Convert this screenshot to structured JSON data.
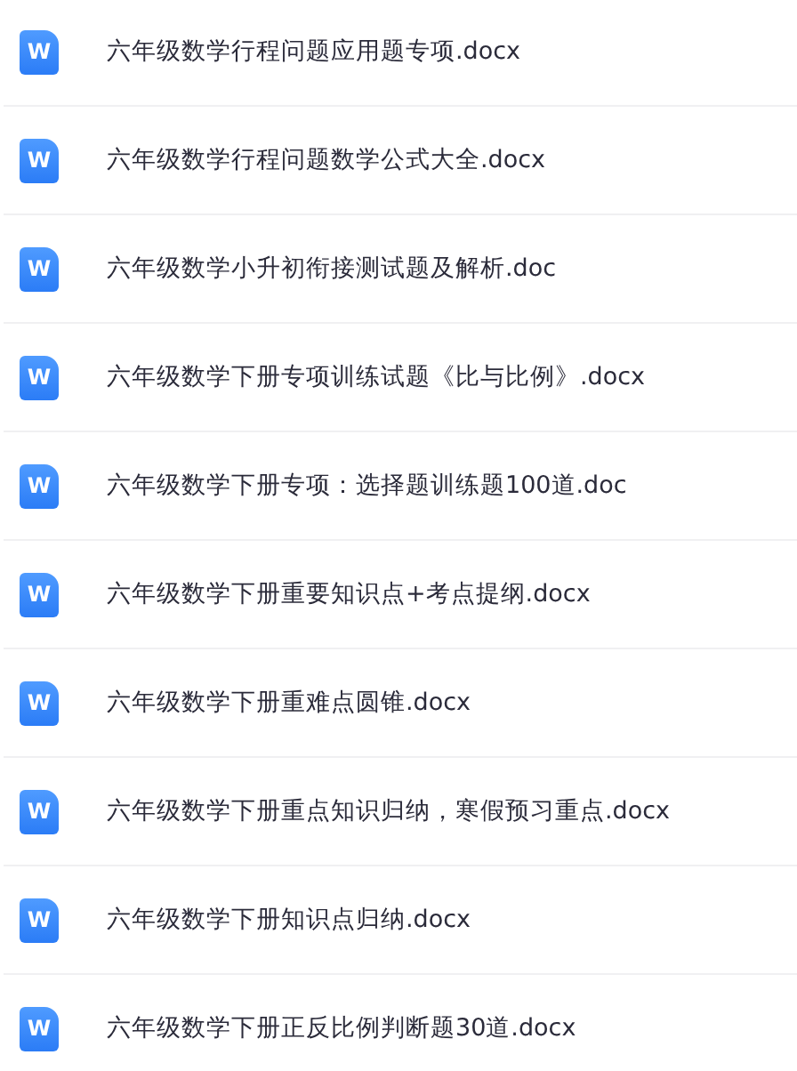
{
  "files": [
    {
      "icon": "W",
      "name": "六年级数学行程问题应用题专项.docx"
    },
    {
      "icon": "W",
      "name": "六年级数学行程问题数学公式大全.docx"
    },
    {
      "icon": "W",
      "name": "六年级数学小升初衔接测试题及解析.doc"
    },
    {
      "icon": "W",
      "name": "六年级数学下册专项训练试题《比与比例》.docx"
    },
    {
      "icon": "W",
      "name": "六年级数学下册专项：选择题训练题100道.doc"
    },
    {
      "icon": "W",
      "name": "六年级数学下册重要知识点+考点提纲.docx"
    },
    {
      "icon": "W",
      "name": "六年级数学下册重难点圆锥.docx"
    },
    {
      "icon": "W",
      "name": "六年级数学下册重点知识归纳，寒假预习重点.docx"
    },
    {
      "icon": "W",
      "name": "六年级数学下册知识点归纳.docx"
    },
    {
      "icon": "W",
      "name": "六年级数学下册正反比例判断题30道.docx"
    }
  ]
}
